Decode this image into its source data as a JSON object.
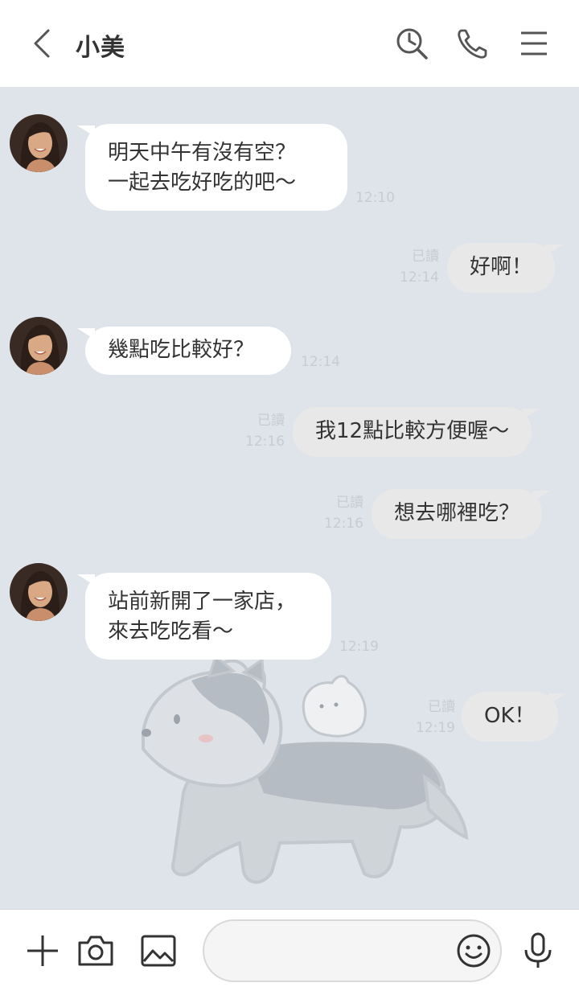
{
  "header": {
    "title": "小美",
    "icons": [
      "back-chevron-icon",
      "search-clock-icon",
      "phone-icon",
      "menu-icon"
    ]
  },
  "messages": [
    {
      "direction": "in",
      "text": "明天中午有沒有空？\n一起去吃好吃的吧〜",
      "time": "12:10"
    },
    {
      "direction": "out",
      "text": "好啊！",
      "read": "已讀",
      "time": "12:14"
    },
    {
      "direction": "in",
      "text": "幾點吃比較好？",
      "time": "12:14"
    },
    {
      "direction": "out",
      "text": "我12點比較方便喔〜",
      "read": "已讀",
      "time": "12:16"
    },
    {
      "direction": "out",
      "text": "想去哪裡吃？",
      "read": "已讀",
      "time": "12:16"
    },
    {
      "direction": "in",
      "text": "站前新開了一家店，\n來去吃吃看〜",
      "time": "12:19"
    },
    {
      "direction": "out",
      "text": "OK！",
      "read": "已讀",
      "time": "12:19"
    }
  ],
  "bottom_bar": {
    "icons": [
      "plus-icon",
      "camera-icon",
      "image-icon",
      "emoji-icon",
      "microphone-icon"
    ],
    "input_value": "",
    "input_placeholder": ""
  },
  "colors": {
    "chat_background": "#dfe4ea",
    "incoming_bubble": "#ffffff",
    "outgoing_bubble": "#e8e8e8",
    "meta_text": "#c7ccd2"
  }
}
